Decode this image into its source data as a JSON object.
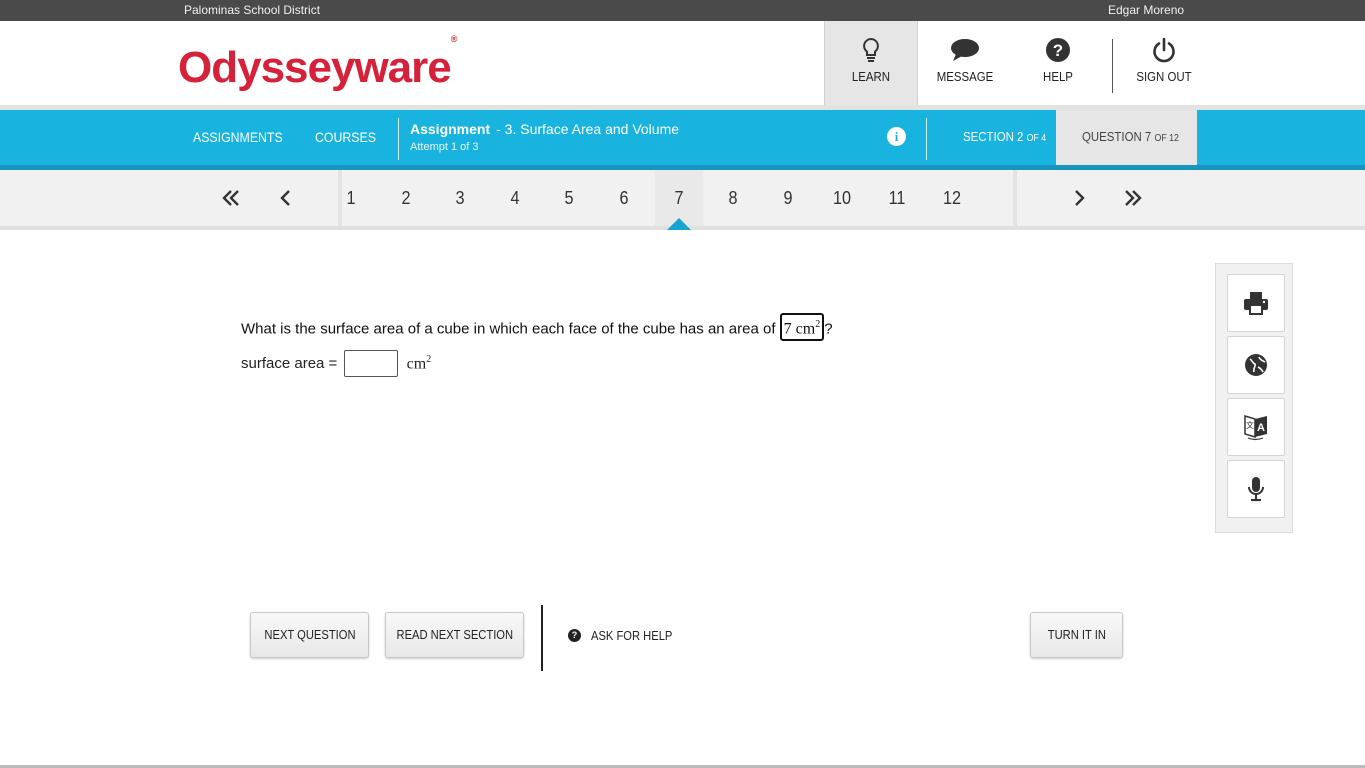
{
  "topbar": {
    "district": "Palominas School District",
    "user": "Edgar Moreno"
  },
  "header": {
    "logo_text": "Odysseyware",
    "logo_mark": "®",
    "nav": {
      "learn": "LEARN",
      "message": "MESSAGE",
      "help": "HELP",
      "signout": "SIGN OUT"
    }
  },
  "bluebar": {
    "assignments": "ASSIGNMENTS",
    "courses": "COURSES",
    "assignment_label": "Assignment",
    "assignment_name": "- 3. Surface Area and Volume",
    "attempt": "Attempt 1 of 3",
    "section_label": "SECTION 2",
    "section_of": "OF 4",
    "question_label": "QUESTION 7",
    "question_of": "OF 12"
  },
  "pager": {
    "pages": [
      "1",
      "2",
      "3",
      "4",
      "5",
      "6",
      "7",
      "8",
      "9",
      "10",
      "11",
      "12"
    ],
    "active_index": 6
  },
  "question": {
    "prompt": "What is the surface area of a cube in which each face of the cube has an area of",
    "face_value": "7 cm",
    "face_exp": "2",
    "end": "?",
    "answer_label": "surface area =",
    "answer_value": "",
    "unit": "cm",
    "unit_exp": "2"
  },
  "tools": [
    "printer-icon",
    "globe-icon",
    "translate-icon",
    "microphone-icon"
  ],
  "footer": {
    "next_question": "NEXT QUESTION",
    "read_next_section": "READ NEXT SECTION",
    "ask_for_help": "ASK FOR HELP",
    "ask_icon_char": "?",
    "turn_it_in": "TURN IT IN"
  },
  "colors": {
    "brand_red": "#d6213a",
    "accent_blue": "#19b3e0",
    "topbar": "#4a4a4a"
  }
}
